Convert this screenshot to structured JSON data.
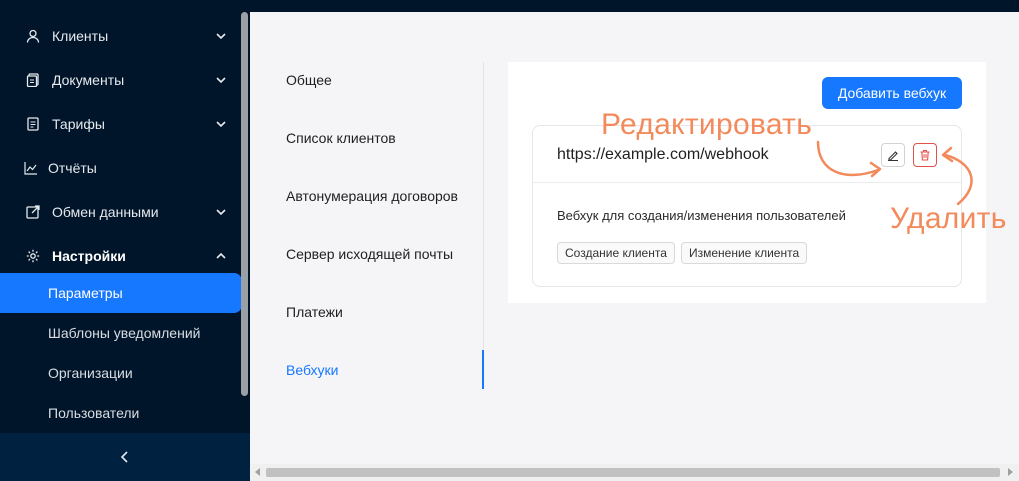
{
  "sidebar": {
    "items": [
      {
        "label": "Клиенты",
        "icon": "user-icon",
        "has_chevron": true
      },
      {
        "label": "Документы",
        "icon": "documents-icon",
        "has_chevron": true
      },
      {
        "label": "Тарифы",
        "icon": "tariff-icon",
        "has_chevron": true
      },
      {
        "label": "Отчёты",
        "icon": "chart-icon",
        "has_chevron": false
      },
      {
        "label": "Обмен данными",
        "icon": "exchange-icon",
        "has_chevron": true
      },
      {
        "label": "Настройки",
        "icon": "gear-icon",
        "has_chevron": true,
        "expanded": true
      }
    ],
    "subitems": [
      {
        "label": "Параметры",
        "active": true
      },
      {
        "label": "Шаблоны уведомлений"
      },
      {
        "label": "Организации"
      },
      {
        "label": "Пользователи"
      }
    ],
    "collapse_icon": "chevron-left-icon"
  },
  "tabs": [
    {
      "label": "Общее"
    },
    {
      "label": "Список клиентов"
    },
    {
      "label": "Автонумерация договоров"
    },
    {
      "label": "Сервер исходящей почты"
    },
    {
      "label": "Платежи"
    },
    {
      "label": "Вебхуки",
      "active": true
    }
  ],
  "webhooks": {
    "add_button": "Добавить вебхук",
    "card": {
      "url": "https://example.com/webhook",
      "description": "Вебхук для создания/изменения пользователей",
      "tags": [
        "Создание клиента",
        "Изменение клиента"
      ],
      "edit_icon": "pencil-icon",
      "delete_icon": "trash-icon"
    }
  },
  "annotations": {
    "edit": "Редактировать",
    "delete": "Удалить"
  },
  "colors": {
    "sidebar_bg": "#001529",
    "accent": "#1677ff",
    "danger": "#e0524a",
    "annotation": "#f28a5c"
  }
}
